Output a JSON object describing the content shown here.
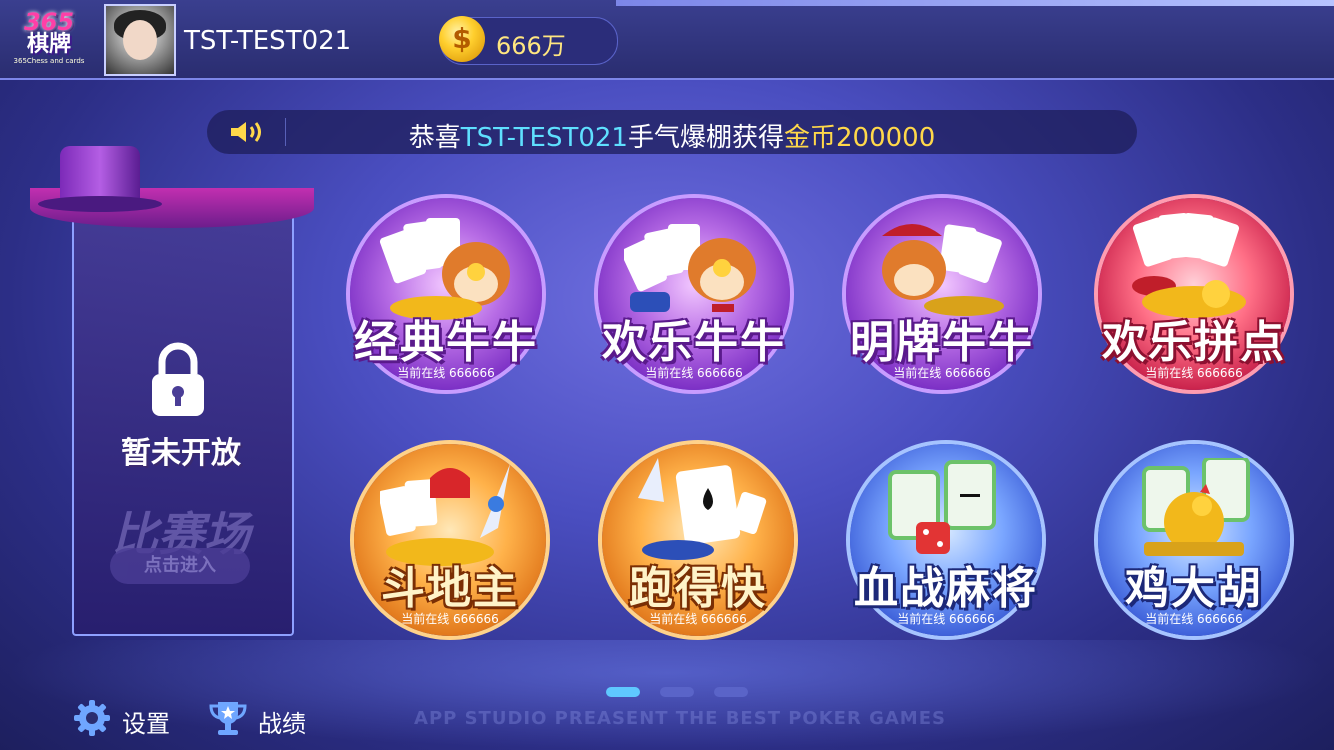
{
  "header": {
    "logo_num": "365",
    "logo_cn": "棋牌",
    "logo_sub": "365Chess and cards",
    "username": "TST-TEST021",
    "gold": "666万"
  },
  "notice": {
    "prefix": "恭喜",
    "user": "TST-TEST021",
    "middle": "手气爆棚获得",
    "reward": "金币200000"
  },
  "match": {
    "lock_label": "暂未开放",
    "title": "比赛场",
    "enter_label": "点击进入"
  },
  "games": [
    {
      "title": "经典牛牛",
      "online": "当前在线 666666",
      "theme": "purple"
    },
    {
      "title": "欢乐牛牛",
      "online": "当前在线 666666",
      "theme": "purple"
    },
    {
      "title": "明牌牛牛",
      "online": "当前在线 666666",
      "theme": "purple"
    },
    {
      "title": "欢乐拼点",
      "online": "当前在线 666666",
      "theme": "red"
    },
    {
      "title": "斗地主",
      "online": "当前在线 666666",
      "theme": "orange"
    },
    {
      "title": "跑得快",
      "online": "当前在线 666666",
      "theme": "orange"
    },
    {
      "title": "血战麻将",
      "online": "当前在线 666666",
      "theme": "blue"
    },
    {
      "title": "鸡大胡",
      "online": "当前在线 666666",
      "theme": "blue"
    }
  ],
  "pager": {
    "pages": 3,
    "active": 1
  },
  "footer": {
    "settings_label": "设置",
    "record_label": "战绩",
    "watermark": "APP STUDIO PREASENT THE BEST POKER GAMES"
  },
  "colors": {
    "accent_cyan": "#5fe0ff",
    "accent_gold": "#ffd84a"
  }
}
